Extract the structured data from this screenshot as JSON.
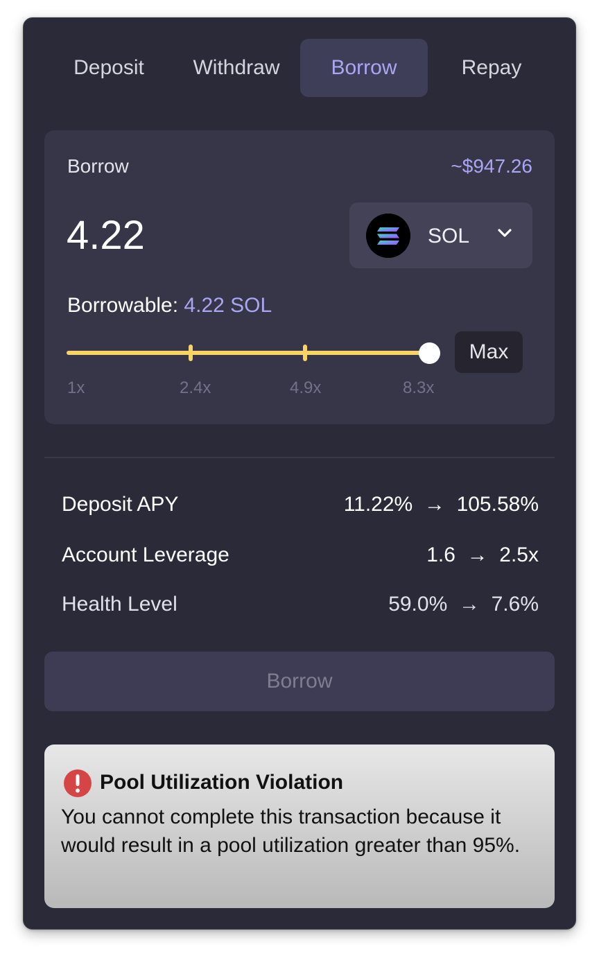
{
  "tabs": [
    {
      "label": "Deposit",
      "active": false
    },
    {
      "label": "Withdraw",
      "active": false
    },
    {
      "label": "Borrow",
      "active": true
    },
    {
      "label": "Repay",
      "active": false
    }
  ],
  "form": {
    "label": "Borrow",
    "usd_value": "~$947.26",
    "amount": "4.22",
    "token": {
      "symbol": "SOL",
      "icon": "solana-logo-icon"
    },
    "borrowable_label": "Borrowable:",
    "borrowable_value": "4.22 SOL",
    "slider": {
      "value_fraction": 1.0,
      "tick_labels": [
        "1x",
        "2.4x",
        "4.9x",
        "8.3x"
      ],
      "tick_marks": [
        "2.4x",
        "4.9x"
      ]
    },
    "max_label": "Max"
  },
  "stats": [
    {
      "name": "Deposit APY",
      "from": "11.22%",
      "arrow": "→",
      "to": "105.58%"
    },
    {
      "name": "Account Leverage",
      "from": "1.6",
      "arrow": "→",
      "to": "2.5x"
    },
    {
      "name": "Health Level",
      "from": "59.0%",
      "arrow": "→",
      "to": "7.6%"
    }
  ],
  "submit": {
    "label": "Borrow",
    "enabled": false
  },
  "alert": {
    "icon": "exclamation-circle-icon",
    "title": "Pool Utilization Violation",
    "message": "You cannot complete this transaction because it would result in a pool utilization greater than 95%."
  },
  "colors": {
    "panel_bg": "#2b2a38",
    "card_bg": "#373649",
    "accent": "#a9a6f2",
    "slider": "#f7d465",
    "alert_icon": "#d64545"
  }
}
